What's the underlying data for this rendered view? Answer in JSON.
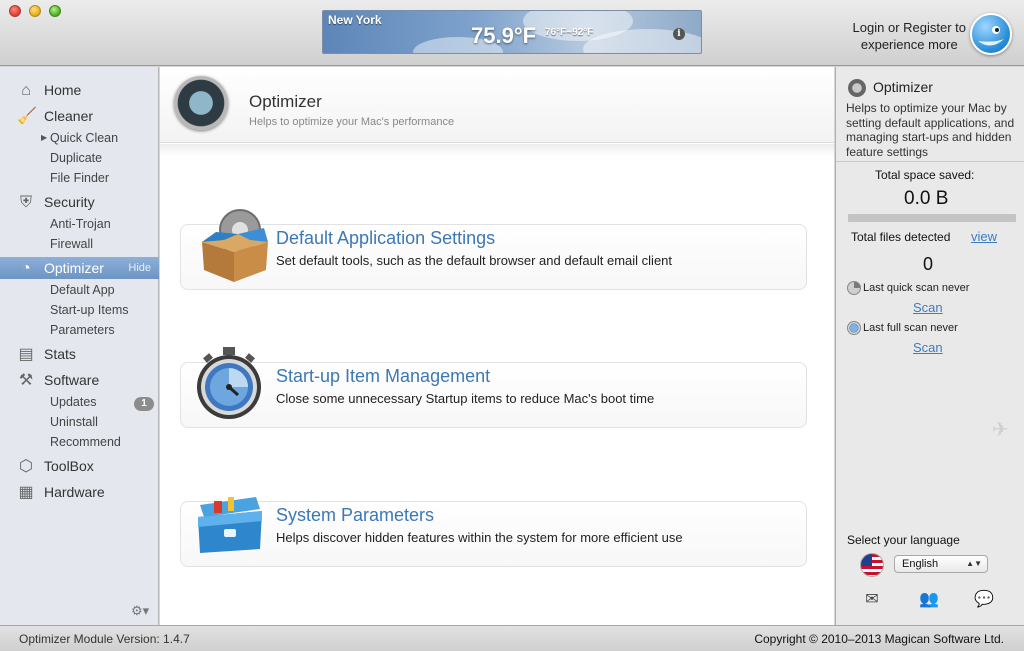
{
  "header": {
    "weather": {
      "city": "New York",
      "temperature": "75.9°F",
      "range": "76°F~92°F",
      "info_glyph": "i"
    },
    "login_line1": "Login or Register to",
    "login_line2": "experience more"
  },
  "sidebar": {
    "home": "Home",
    "cleaner": "Cleaner",
    "cleaner_items": [
      "Quick Clean",
      "Duplicate",
      "File Finder"
    ],
    "security": "Security",
    "security_items": [
      "Anti-Trojan",
      "Firewall"
    ],
    "optimizer": "Optimizer",
    "optimizer_hide": "Hide",
    "optimizer_items": [
      "Default App",
      "Start-up Items",
      "Parameters"
    ],
    "stats": "Stats",
    "software": "Software",
    "software_items": [
      "Updates",
      "Uninstall",
      "Recommend"
    ],
    "updates_badge": "1",
    "toolbox": "ToolBox",
    "hardware": "Hardware",
    "gear_menu": "⚙▾"
  },
  "main": {
    "title": "Optimizer",
    "subtitle": "Helps to optimize your Mac's performance",
    "cards": [
      {
        "title": "Default Application Settings",
        "desc": "Set default tools, such as the default browser and default email client",
        "icon": "box-gear-icon"
      },
      {
        "title": "Start-up Item Management",
        "desc": "Close some unnecessary Startup items to reduce Mac's boot time",
        "icon": "stopwatch-icon"
      },
      {
        "title": "System Parameters",
        "desc": "Helps discover hidden features within the system for more efficient use",
        "icon": "toolbox-icon"
      }
    ]
  },
  "panel": {
    "title": "Optimizer",
    "description": "Helps to optimize your Mac by setting default applications, and managing start-ups and hidden feature settings",
    "space_label": "Total space saved:",
    "space_value": "0.0 B",
    "files_label": "Total files detected",
    "files_view": "view",
    "files_value": "0",
    "quick_scan_text": "Last quick scan never",
    "quick_scan_link": "Scan",
    "full_scan_text": "Last full scan never",
    "full_scan_link": "Scan",
    "language_label": "Select your language",
    "language_value": "English"
  },
  "status": {
    "version": "Optimizer Module Version: 1.4.7",
    "copyright": "Copyright © 2010–2013 Magican Software Ltd."
  },
  "colors": {
    "accent_link": "#3c78b5",
    "active_nav": "#7a9fcd"
  }
}
